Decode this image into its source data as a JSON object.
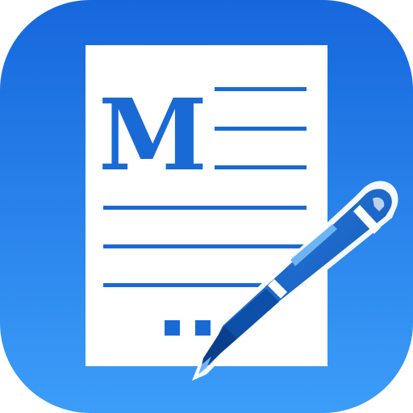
{
  "icon": {
    "name": "markdown-writer-app-icon",
    "glyph": "M",
    "colors": {
      "background_top": "#1E6FE0",
      "background_bottom": "#3A9BF8",
      "paper": "#FFFFFF",
      "ink": "#1A6AD6",
      "pen_body": "#1460C4",
      "pen_highlight": "#6EB3F5",
      "pen_dark": "#0B3F8C"
    }
  }
}
